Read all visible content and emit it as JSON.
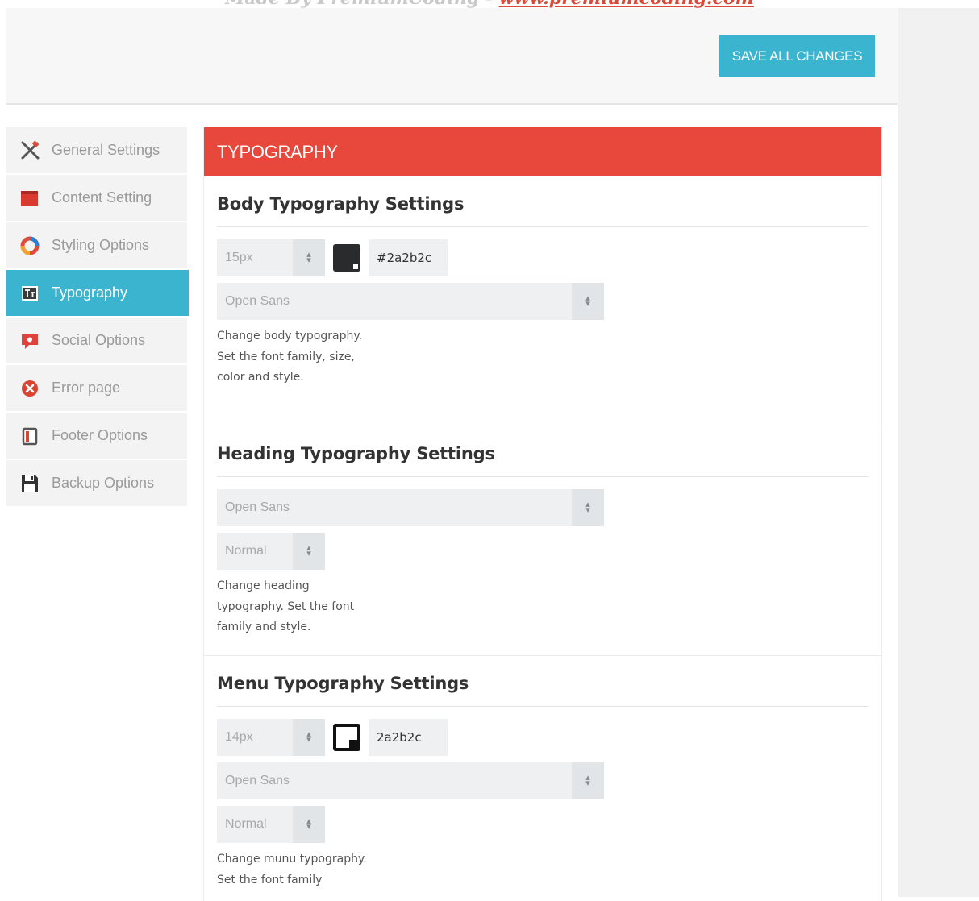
{
  "watermark": {
    "text": "Made By PremiumCoding - ",
    "link": "www.premiumcoding.com"
  },
  "toolbar": {
    "save_label": "SAVE ALL CHANGES"
  },
  "sidebar": {
    "items": [
      {
        "label": "General Settings",
        "icon": "tools-icon"
      },
      {
        "label": "Content Setting",
        "icon": "content-icon"
      },
      {
        "label": "Styling Options",
        "icon": "palette-icon"
      },
      {
        "label": "Typography",
        "icon": "typography-icon",
        "active": true
      },
      {
        "label": "Social Options",
        "icon": "social-icon"
      },
      {
        "label": "Error page",
        "icon": "error-icon"
      },
      {
        "label": "Footer Options",
        "icon": "footer-icon"
      },
      {
        "label": "Backup Options",
        "icon": "save-icon"
      }
    ]
  },
  "panel": {
    "title": "TYPOGRAPHY",
    "body": {
      "heading": "Body Typography Settings",
      "size": "15px",
      "color_hex": "#2a2b2c",
      "font": "Open Sans",
      "description": "Change body typography. Set the font family, size, color and style."
    },
    "heading": {
      "heading": "Heading Typography Settings",
      "font": "Open Sans",
      "style": "Normal",
      "description": "Change heading typography. Set the font family and style."
    },
    "menu": {
      "heading": "Menu Typography Settings",
      "size": "14px",
      "color_hex": "2a2b2c",
      "font": "Open Sans",
      "style": "Normal",
      "description": "Change munu typography. Set the font family"
    }
  },
  "colors": {
    "accent": "#3bb5cf",
    "header": "#e8473b",
    "swatch": "#2a2b2c"
  }
}
